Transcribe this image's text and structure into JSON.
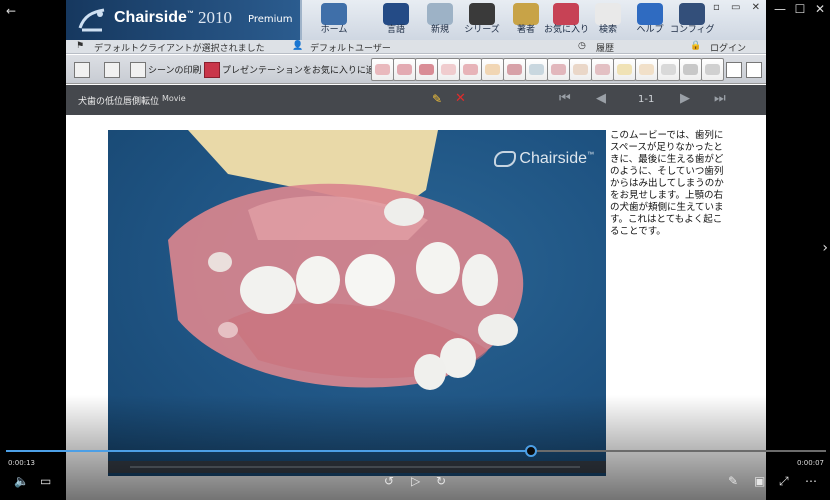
{
  "window": {
    "back": "←",
    "controls": [
      "□",
      "—",
      "☐",
      "✕"
    ],
    "side_next": "›"
  },
  "app": {
    "brand": "Chairside",
    "brand_tm": "™",
    "year": "2010",
    "edition": "Premium",
    "toolbar": [
      {
        "label": "ホーム",
        "icon": "dental-chair-icon",
        "color": "#3f6fa9"
      },
      {
        "label": "言語",
        "icon": "language-icon",
        "color": "#244b86"
      },
      {
        "label": "新規",
        "icon": "new-icon",
        "color": "#9db2c6"
      },
      {
        "label": "シリーズ",
        "icon": "clapper-icon",
        "color": "#3a3a3a"
      },
      {
        "label": "著者",
        "icon": "author-icon",
        "color": "#c8a347"
      },
      {
        "label": "お気に入り",
        "icon": "favorites-icon",
        "color": "#c74255"
      },
      {
        "label": "検索",
        "icon": "teeth-search-icon",
        "color": "#e9e9e9"
      },
      {
        "label": "ヘルプ",
        "icon": "help-icon",
        "color": "#2f6bc1"
      },
      {
        "label": "コンフィグ",
        "icon": "config-icon",
        "color": "#334f7a"
      }
    ],
    "window_controls": "▫ ▭ ✕"
  },
  "status": {
    "client": "デフォルトクライアントが選択されました",
    "user": "デフォルトユーザー",
    "history": "履歴",
    "login": "ログイン"
  },
  "toolbar2": {
    "print_scene": "シーンの印刷",
    "add_favorite": "プレゼンテーションをお気に入りに追加",
    "thumb_colors": [
      "#e9b9bd",
      "#e3aab2",
      "#d98c95",
      "#f0ccce",
      "#e7b3b8",
      "#f1d6b4",
      "#d7a1a8",
      "#c9d7df",
      "#e2b7bc",
      "#ead7c8",
      "#e3c0c3",
      "#f0e2b5",
      "#f1e0c9",
      "#d9d9d9",
      "#c8c8c8",
      "#d0d0d0"
    ]
  },
  "movie": {
    "title": "犬歯の低位唇側転位",
    "tag": "Movie",
    "page": "1-1",
    "watermark": "Chairside",
    "description": "このムービーでは、歯列にスペースが足りなかったときに、最後に生える歯がどのように、そしていつ歯列からはみ出してしまうのかをお見せします。上顎の右の犬歯が頬側に生えています。これはとてもよく起こることです。"
  },
  "player": {
    "current": "0:00:13",
    "duration": "0:00:07",
    "progress": 0.64
  }
}
